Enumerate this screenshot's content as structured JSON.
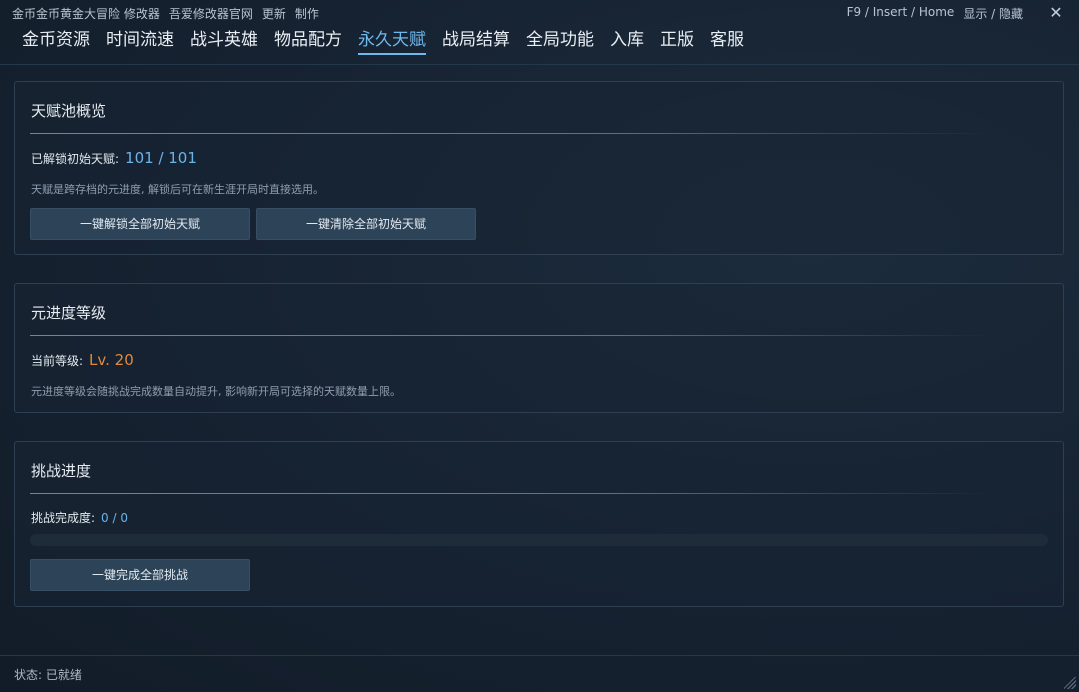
{
  "titlebar": {
    "items": [
      "金币金币黄金大冒险 修改器",
      "吾爱修改器官网",
      "更新",
      "制作"
    ],
    "hotkeys": "F9 / Insert / Home",
    "toggle": "显示 / 隐藏",
    "close_icon": "close-icon"
  },
  "tabs": [
    {
      "label": "金币资源"
    },
    {
      "label": "时间流速"
    },
    {
      "label": "战斗英雄"
    },
    {
      "label": "物品配方"
    },
    {
      "label": "永久天赋",
      "active": true
    },
    {
      "label": "战局结算"
    },
    {
      "label": "全局功能"
    },
    {
      "label": "入库"
    },
    {
      "label": "正版"
    },
    {
      "label": "客服"
    }
  ],
  "talent_pool": {
    "title": "天赋池概览",
    "unlocked_label": "已解锁初始天赋:",
    "unlocked_value": "101 / 101",
    "description": "天赋是跨存档的元进度, 解锁后可在新生涯开局时直接选用。",
    "unlock_all_button": "一键解锁全部初始天赋",
    "clear_all_button": "一键清除全部初始天赋"
  },
  "meta_level": {
    "title": "元进度等级",
    "level_label": "当前等级:",
    "level_value": "Lv. 20",
    "description": "元进度等级会随挑战完成数量自动提升, 影响新开局可选择的天赋数量上限。"
  },
  "challenge": {
    "title": "挑战进度",
    "completion_label": "挑战完成度:",
    "completion_value": "0 / 0",
    "progress_fraction": 0,
    "complete_all_button": "一键完成全部挑战"
  },
  "status": {
    "text": "状态: 已就绪"
  },
  "colors": {
    "accent_blue": "#6fb8ec",
    "value_orange": "#e08a3a",
    "button_bg": "#2c4358"
  }
}
